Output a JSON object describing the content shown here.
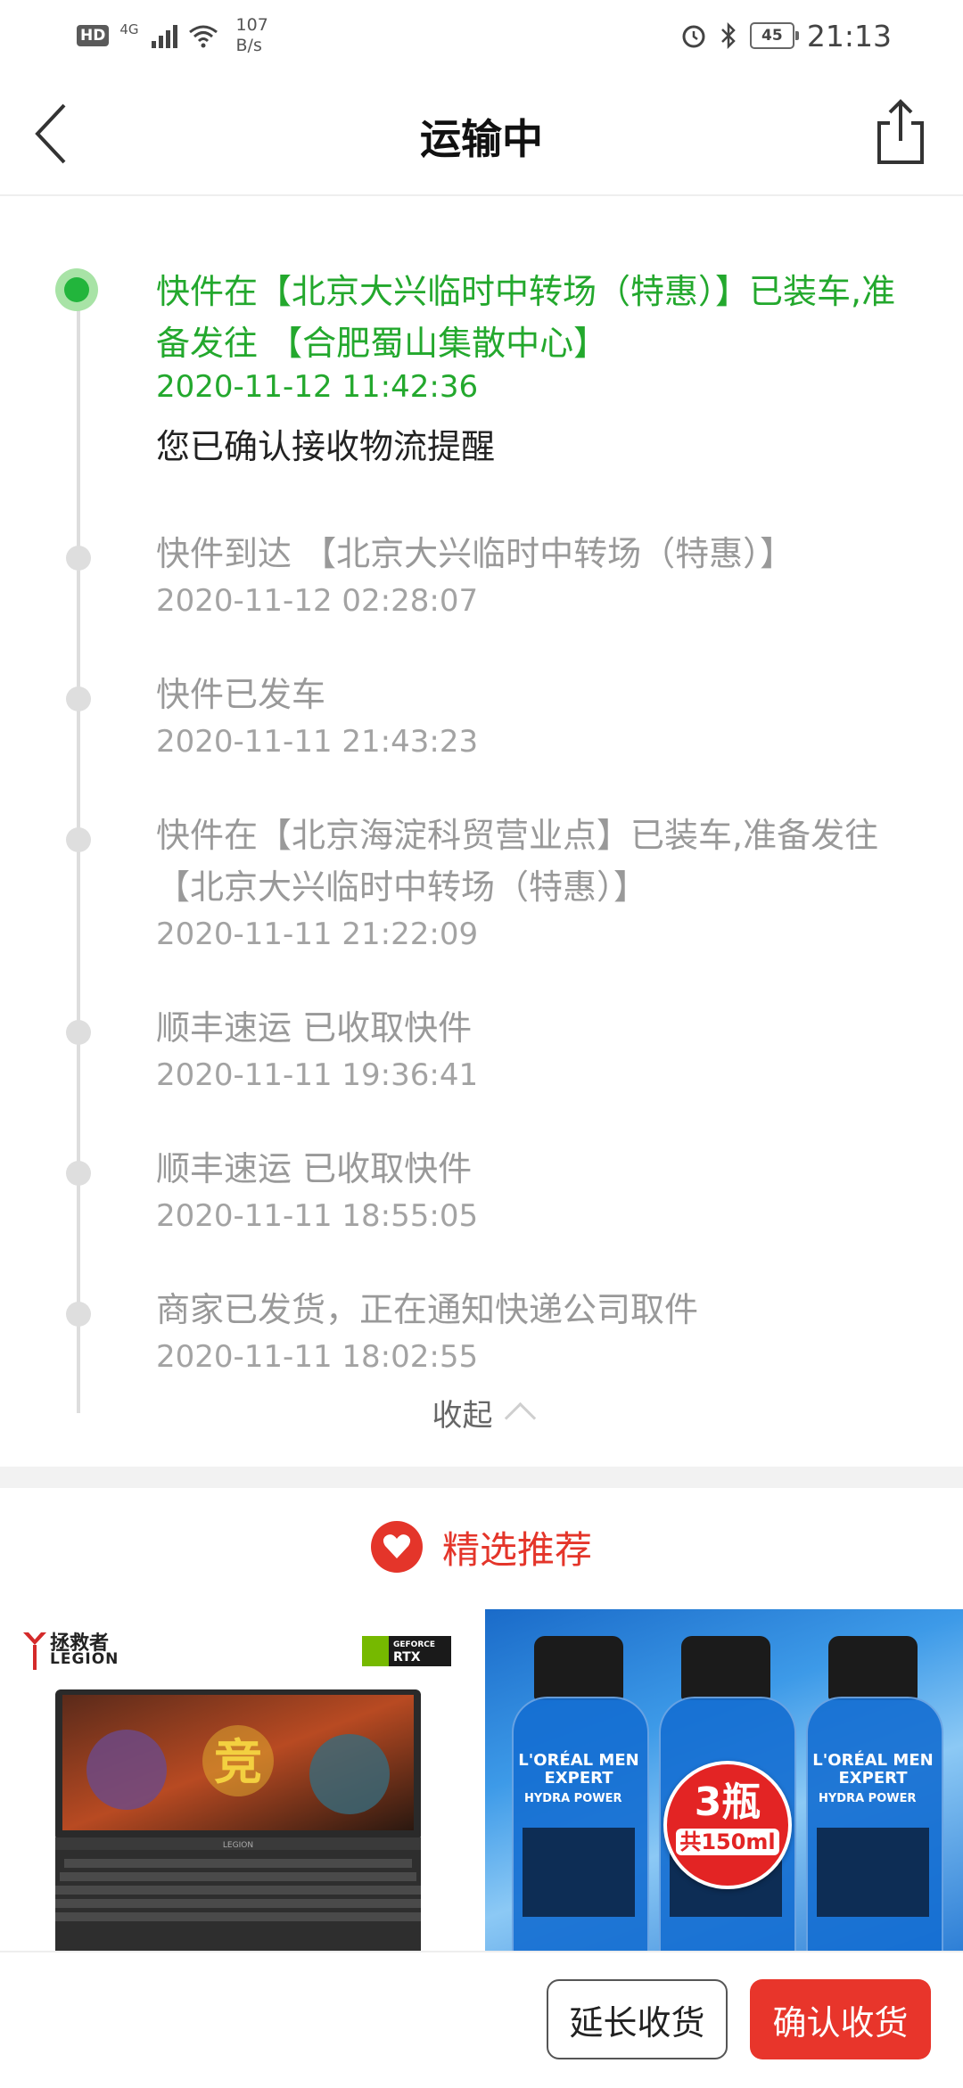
{
  "status_bar": {
    "hd": "HD",
    "network": "4G",
    "speed_value": "107",
    "speed_unit": "B/s",
    "battery": "45",
    "time": "21:13"
  },
  "header": {
    "title": "运输中",
    "back_icon": "chevron-left-icon",
    "share_icon": "share-icon"
  },
  "timeline": {
    "items": [
      {
        "text": "快件在【北京大兴临时中转场（特惠）】已装车,准备发往 【合肥蜀山集散中心】",
        "time": "2020-11-12 11:42:36",
        "note": "您已确认接收物流提醒",
        "current": true
      },
      {
        "text": "快件到达 【北京大兴临时中转场（特惠）】",
        "time": "2020-11-12 02:28:07"
      },
      {
        "text": "快件已发车",
        "time": "2020-11-11 21:43:23"
      },
      {
        "text": "快件在【北京海淀科贸营业点】已装车,准备发往 【北京大兴临时中转场（特惠）】",
        "time": "2020-11-11 21:22:09"
      },
      {
        "text": "顺丰速运 已收取快件",
        "time": "2020-11-11 19:36:41"
      },
      {
        "text": "顺丰速运 已收取快件",
        "time": "2020-11-11 18:55:05"
      },
      {
        "text": "商家已发货，正在通知快递公司取件",
        "time": "2020-11-11 18:02:55"
      }
    ],
    "collapse_label": "收起"
  },
  "recommend": {
    "title": "精选推荐",
    "products": [
      {
        "brand_cn": "拯救者",
        "brand_en": "LEGION",
        "badge_top": "GEFORCE",
        "badge_main": "RTX",
        "screen_char": "竞",
        "laptop_label": "LEGION"
      },
      {
        "brand": "L'ORÉAL MEN EXPERT",
        "line": "HYDRA POWER",
        "badge_big": "3瓶",
        "badge_small": "共150ml"
      }
    ]
  },
  "actions": {
    "extend_label": "延长收货",
    "confirm_label": "确认收货"
  },
  "colors": {
    "accent_green": "#23a82d",
    "accent_red": "#e4352a"
  }
}
